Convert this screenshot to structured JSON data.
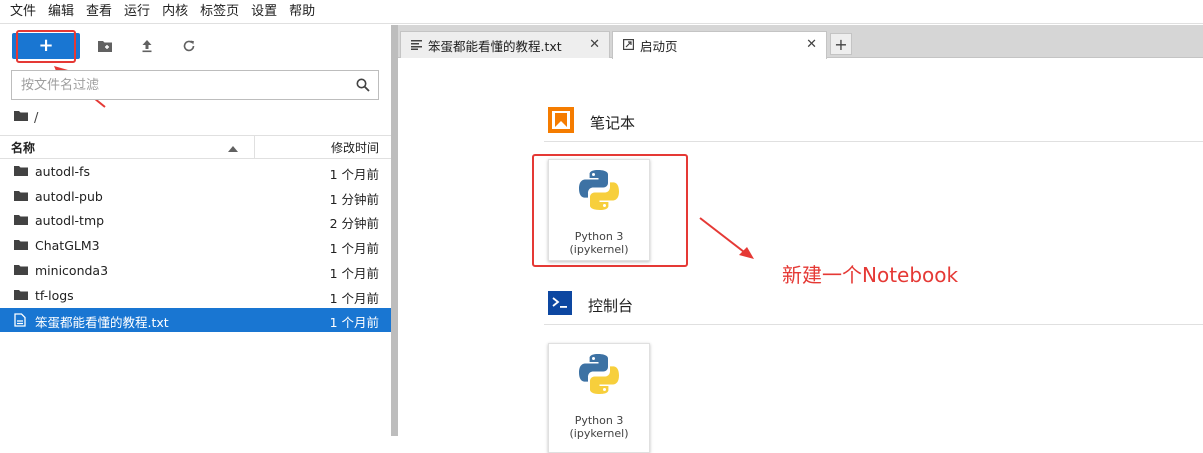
{
  "menu": [
    "文件",
    "编辑",
    "查看",
    "运行",
    "内核",
    "标签页",
    "设置",
    "帮助"
  ],
  "toolbar": {
    "new_label": "+",
    "new_folder_icon": "new-folder-icon",
    "upload_icon": "upload-icon",
    "refresh_icon": "refresh-icon"
  },
  "filter": {
    "placeholder": "按文件名过滤"
  },
  "breadcrumb": {
    "path": "/"
  },
  "file_list": {
    "col_name": "名称",
    "col_modified": "修改时间",
    "rows": [
      {
        "name": "autodl-fs",
        "modified": "1 个月前",
        "type": "folder"
      },
      {
        "name": "autodl-pub",
        "modified": "1 分钟前",
        "type": "folder"
      },
      {
        "name": "autodl-tmp",
        "modified": "2 分钟前",
        "type": "folder"
      },
      {
        "name": "ChatGLM3",
        "modified": "1 个月前",
        "type": "folder"
      },
      {
        "name": "miniconda3",
        "modified": "1 个月前",
        "type": "folder"
      },
      {
        "name": "tf-logs",
        "modified": "1 个月前",
        "type": "folder"
      },
      {
        "name": "笨蛋都能看懂的教程.txt",
        "modified": "1 个月前",
        "type": "file",
        "selected": true
      }
    ]
  },
  "tabs": [
    {
      "label": "笨蛋都能看懂的教程.txt",
      "icon": "text-file-icon",
      "active": false
    },
    {
      "label": "启动页",
      "icon": "launcher-icon",
      "active": true
    }
  ],
  "launcher": {
    "notebook_section": "笔记本",
    "console_section": "控制台",
    "notebook_card": {
      "line1": "Python 3",
      "line2": "(ipykernel)"
    },
    "console_card": {
      "line1": "Python 3",
      "line2": "(ipykernel)"
    }
  },
  "annotation": "新建一个Notebook",
  "colors": {
    "accent": "#1976d2",
    "annotation_red": "#e53935",
    "notebook_orange": "#f57c00",
    "console_blue": "#0d47a1"
  }
}
